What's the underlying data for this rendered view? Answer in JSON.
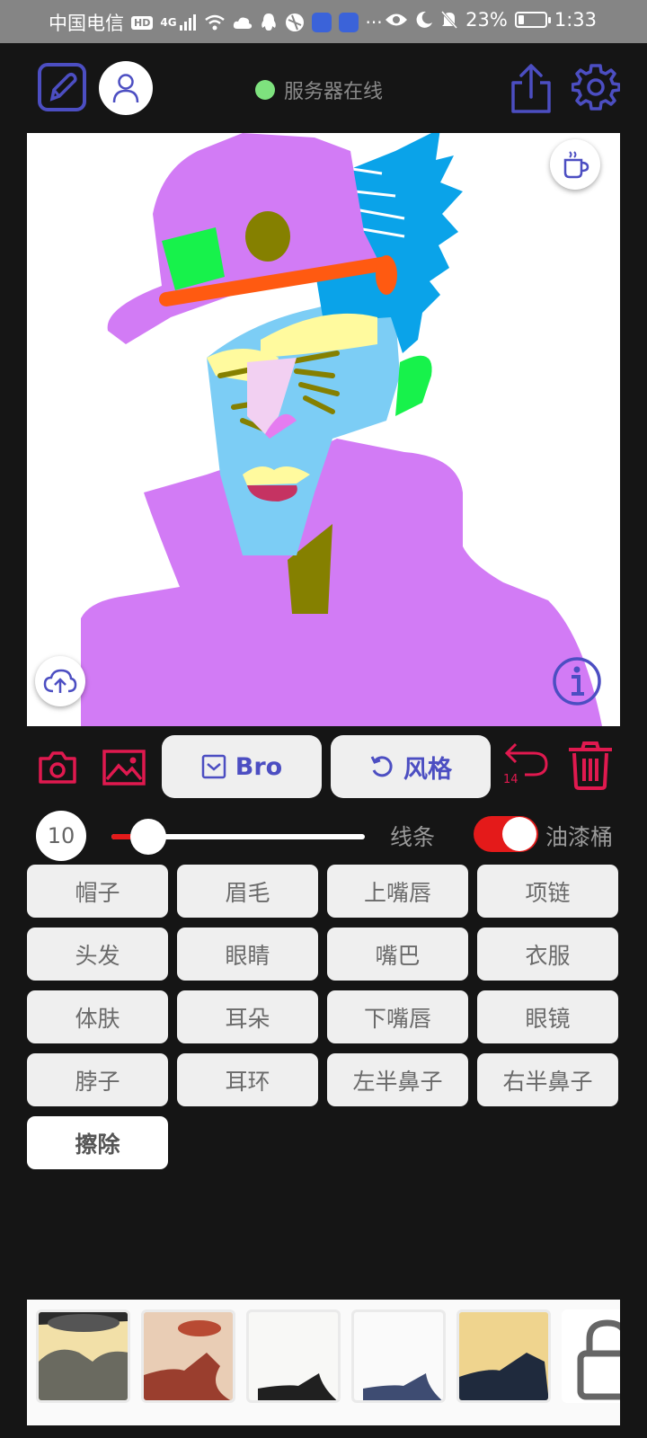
{
  "status_bar": {
    "carrier": "中国电信",
    "hd_badge": "HD",
    "network_type": "4G",
    "more": "···",
    "battery_text": "23%",
    "battery_level": 0.23,
    "time": "1:33"
  },
  "header": {
    "server_status": "服务器在线",
    "status_color": "#7ee27e",
    "icons": [
      "edit-icon",
      "user-icon",
      "share-icon",
      "settings-icon"
    ]
  },
  "canvas": {
    "corner_icons": [
      "coffee-icon",
      "upload-cloud-icon",
      "info-icon"
    ]
  },
  "toolbar": {
    "bro_label": "Bro",
    "style_label": "风格",
    "undo_count": "14",
    "icons": [
      "camera-icon",
      "image-icon",
      "undo-icon",
      "trash-icon"
    ],
    "accent_color": "#e0194f",
    "button_text_color": "#4c4ec2"
  },
  "brush": {
    "size": "10",
    "size_level": 0.145,
    "lines_label": "线条",
    "bucket_label": "油漆桶",
    "bucket_enabled": true
  },
  "parts": {
    "items": [
      "帽子",
      "眉毛",
      "上嘴唇",
      "项链",
      "头发",
      "眼睛",
      "嘴巴",
      "衣服",
      "体肤",
      "耳朵",
      "下嘴唇",
      "眼镜",
      "脖子",
      "耳环",
      "左半鼻子",
      "右半鼻子",
      "擦除"
    ],
    "active": "擦除"
  },
  "styles": {
    "icons": [
      "lock-icon"
    ]
  }
}
